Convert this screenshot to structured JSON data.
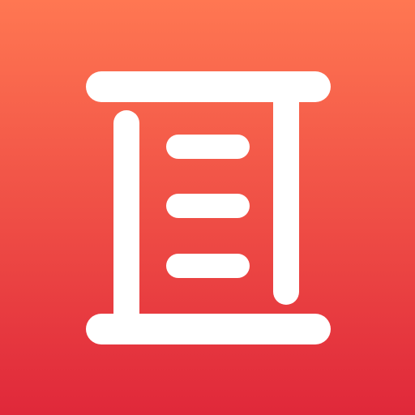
{
  "app_icon": {
    "name": "scroll-list-icon",
    "colors": {
      "gradient_top": "#FF7752",
      "gradient_bottom": "#E0283A",
      "glyph": "#FFFFFF"
    }
  }
}
